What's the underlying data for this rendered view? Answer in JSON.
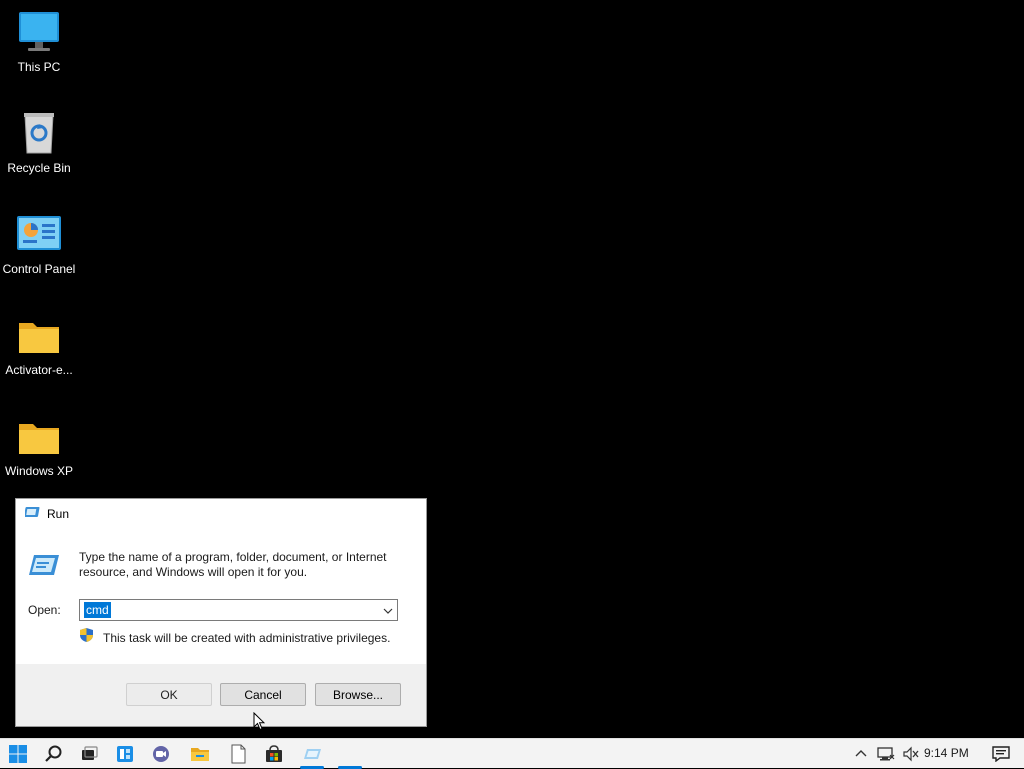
{
  "desktop": {
    "icons": [
      {
        "label": "This PC",
        "icon": "monitor-icon"
      },
      {
        "label": "Recycle Bin",
        "icon": "recycle-bin-icon"
      },
      {
        "label": "Control Panel",
        "icon": "control-panel-icon"
      },
      {
        "label": "Activator-e...",
        "icon": "folder-icon"
      },
      {
        "label": "Windows XP",
        "icon": "folder-icon"
      }
    ]
  },
  "run_dialog": {
    "title": "Run",
    "description": "Type the name of a program, folder, document, or Internet resource, and Windows will open it for you.",
    "open_label": "Open:",
    "open_value": "cmd",
    "admin_note": "This task will be created with administrative privileges.",
    "buttons": {
      "ok": "OK",
      "cancel": "Cancel",
      "browse": "Browse..."
    }
  },
  "taskbar": {
    "apps": [
      "start-icon",
      "search-icon",
      "task-view-icon",
      "widgets-icon",
      "chat-icon",
      "file-explorer-icon",
      "notepad-icon",
      "store-icon",
      "run-icon",
      "app-icon"
    ],
    "clock": "9:14 PM"
  },
  "colors": {
    "accent": "#0078d7",
    "desktop": "#000000",
    "taskbar": "#f3f3f3",
    "folder": "#f8c840"
  }
}
